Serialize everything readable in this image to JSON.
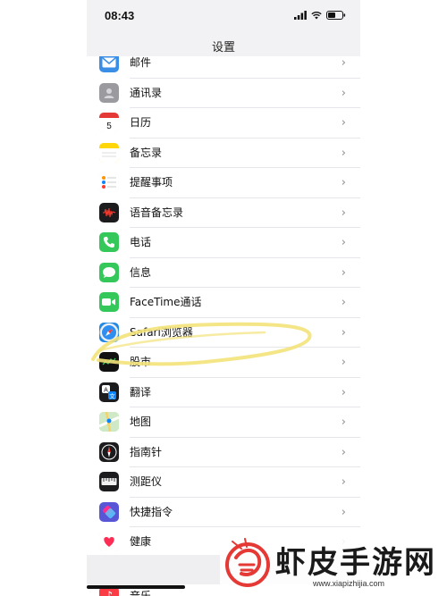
{
  "status_bar": {
    "time": "08:43"
  },
  "nav": {
    "title": "设置"
  },
  "settings_items": [
    {
      "label": "邮件",
      "icon": "mail-icon",
      "color": "#3a8ee6"
    },
    {
      "label": "通讯录",
      "icon": "contacts-icon",
      "color": "#9a9a9f"
    },
    {
      "label": "日历",
      "icon": "calendar-icon",
      "color": "#ffffff"
    },
    {
      "label": "备忘录",
      "icon": "notes-icon",
      "color": "#ffd60a"
    },
    {
      "label": "提醒事项",
      "icon": "reminders-icon",
      "color": "#ffffff"
    },
    {
      "label": "语音备忘录",
      "icon": "voice-memos-icon",
      "color": "#1c1c1e"
    },
    {
      "label": "电话",
      "icon": "phone-icon",
      "color": "#34c759"
    },
    {
      "label": "信息",
      "icon": "messages-icon",
      "color": "#34c759"
    },
    {
      "label": "FaceTime通话",
      "icon": "facetime-icon",
      "color": "#34c759"
    },
    {
      "label": "Safari浏览器",
      "icon": "safari-icon",
      "color": "#1e88e5"
    },
    {
      "label": "股市",
      "icon": "stocks-icon",
      "color": "#111111"
    },
    {
      "label": "翻译",
      "icon": "translate-icon",
      "color": "#1c1c1e"
    },
    {
      "label": "地图",
      "icon": "maps-icon",
      "color": "#7ed37e"
    },
    {
      "label": "指南针",
      "icon": "compass-icon",
      "color": "#1c1c1e"
    },
    {
      "label": "测距仪",
      "icon": "measure-icon",
      "color": "#1c1c1e"
    },
    {
      "label": "快捷指令",
      "icon": "shortcuts-icon",
      "color": "#5856d6"
    },
    {
      "label": "健康",
      "icon": "health-icon",
      "color": "#ffffff"
    }
  ],
  "next_section": {
    "label": "音乐",
    "icon": "music-icon",
    "color": "#fc3c44"
  },
  "highlight": {
    "color": "#f3e37a",
    "target": "Safari浏览器"
  },
  "watermark": {
    "text": "虾皮手游网",
    "url": "www.xiapizhijia.com",
    "logo_color": "#e53935"
  }
}
